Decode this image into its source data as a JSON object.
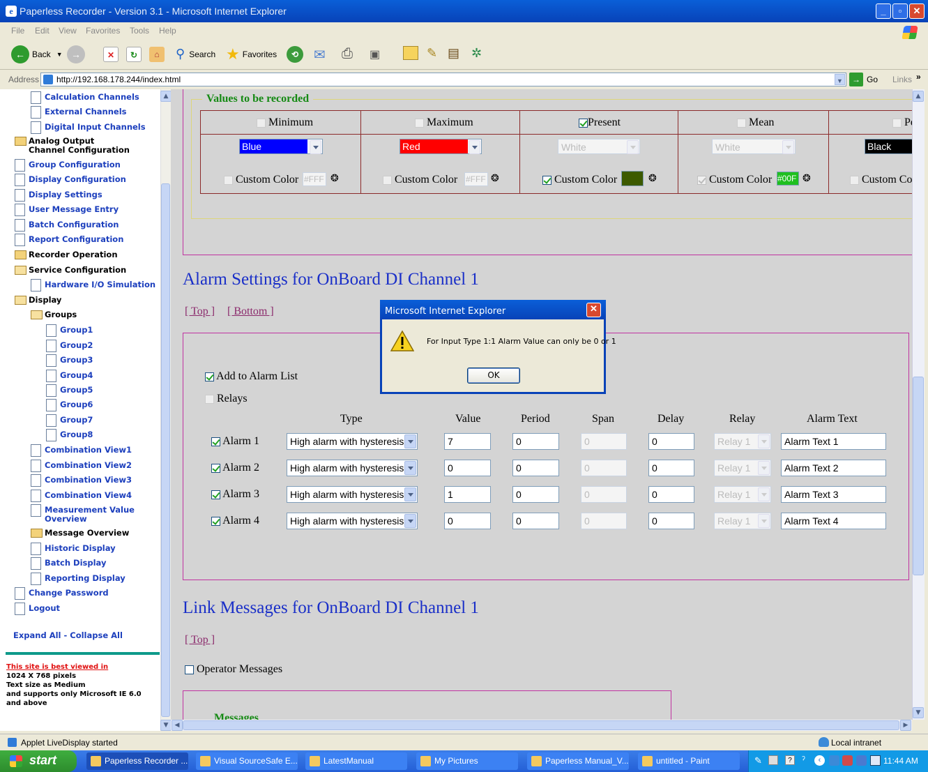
{
  "window": {
    "title": "Paperless Recorder - Version 3.1 - Microsoft Internet Explorer"
  },
  "menu": [
    "File",
    "Edit",
    "View",
    "Favorites",
    "Tools",
    "Help"
  ],
  "toolbar": {
    "back": "Back",
    "search": "Search",
    "favorites": "Favorites"
  },
  "address": {
    "label": "Address",
    "url": "http://192.168.178.244/index.html",
    "go": "Go",
    "links": "Links"
  },
  "sidebar": {
    "items": [
      {
        "label": "Calculation Channels"
      },
      {
        "label": "External Channels"
      },
      {
        "label": "Digital Input Channels"
      },
      {
        "label": "Analog Output Channel Configuration"
      },
      {
        "label": "Group Configuration"
      },
      {
        "label": "Display Configuration"
      },
      {
        "label": "Display Settings"
      },
      {
        "label": "User Message Entry"
      },
      {
        "label": "Batch Configuration"
      },
      {
        "label": "Report Configuration"
      },
      {
        "label": "Recorder Operation"
      },
      {
        "label": "Service Configuration"
      },
      {
        "label": "Hardware I/O Simulation"
      },
      {
        "label": "Display"
      },
      {
        "label": "Groups"
      },
      {
        "label": "Group1"
      },
      {
        "label": "Group2"
      },
      {
        "label": "Group3"
      },
      {
        "label": "Group4"
      },
      {
        "label": "Group5"
      },
      {
        "label": "Group6"
      },
      {
        "label": "Group7"
      },
      {
        "label": "Group8"
      },
      {
        "label": "Combination View1"
      },
      {
        "label": "Combination View2"
      },
      {
        "label": "Combination View3"
      },
      {
        "label": "Combination View4"
      },
      {
        "label": "Measurement Value Overview"
      },
      {
        "label": "Message Overview"
      },
      {
        "label": "Historic Display"
      },
      {
        "label": "Batch Display"
      },
      {
        "label": "Reporting Display"
      },
      {
        "label": "Change Password"
      },
      {
        "label": "Logout"
      }
    ],
    "expand_all": "Expand All",
    "separator": " - ",
    "collapse_all": "Collapse All",
    "notice_link": "This site is best viewed in",
    "notice_lines": [
      "1024 X 768 pixels",
      "Text size as Medium",
      "and supports only Microsoft IE 6.0",
      "and above"
    ]
  },
  "values_section": {
    "legend": "Values to be recorded",
    "columns": [
      {
        "label": "Minimum",
        "checked": false,
        "color": "Blue",
        "color_hex": "#0000ff",
        "custom_label": "Custom Color",
        "custom_checked": false,
        "custom_value": "#FFF",
        "custom_hex": "#ffffff"
      },
      {
        "label": "Maximum",
        "checked": false,
        "color": "Red",
        "color_hex": "#ff0000",
        "custom_label": "Custom Color",
        "custom_checked": false,
        "custom_value": "#FFF",
        "custom_hex": "#ffffff"
      },
      {
        "label": "Present",
        "checked": true,
        "color": "White",
        "color_hex": "#ffffff",
        "custom_label": "Custom Color",
        "custom_checked": true,
        "custom_value": "",
        "custom_hex": "#3c5a00"
      },
      {
        "label": "Mean",
        "checked": false,
        "color": "White",
        "color_hex": "#ffffff",
        "custom_label": "Custom Color",
        "custom_checked": true,
        "custom_value": "#00F",
        "custom_hex": "#1fbf1f"
      },
      {
        "label": "Pe",
        "checked": false,
        "color": "Black",
        "color_hex": "#000000",
        "custom_label": "Custom Co",
        "custom_checked": false,
        "custom_value": "",
        "custom_hex": "#ffffff"
      }
    ]
  },
  "alarm_section": {
    "title": "Alarm Settings for OnBoard DI Channel 1",
    "link_top": "[ Top ]",
    "link_bottom": "[ Bottom ]",
    "add_to_alarm_list": "Add to Alarm List",
    "relays": "Relays",
    "headers": {
      "type": "Type",
      "value": "Value",
      "period": "Period",
      "span": "Span",
      "delay": "Delay",
      "relay": "Relay",
      "text": "Alarm Text"
    },
    "rows": [
      {
        "label": "Alarm 1",
        "type": "High alarm with hysteresis",
        "value": "7",
        "period": "0",
        "span": "0",
        "delay": "0",
        "relay": "Relay 1",
        "text": "Alarm Text 1"
      },
      {
        "label": "Alarm 2",
        "type": "High alarm with hysteresis",
        "value": "0",
        "period": "0",
        "span": "0",
        "delay": "0",
        "relay": "Relay 1",
        "text": "Alarm Text 2"
      },
      {
        "label": "Alarm 3",
        "type": "High alarm with hysteresis",
        "value": "1",
        "period": "0",
        "span": "0",
        "delay": "0",
        "relay": "Relay 1",
        "text": "Alarm Text 3"
      },
      {
        "label": "Alarm 4",
        "type": "High alarm with hysteresis",
        "value": "0",
        "period": "0",
        "span": "0",
        "delay": "0",
        "relay": "Relay 1",
        "text": "Alarm Text 4"
      }
    ]
  },
  "link_section": {
    "title": "Link Messages for OnBoard DI Channel 1",
    "link_top": "[ Top ]",
    "operator_messages": "Operator Messages",
    "messages_legend": "Messages"
  },
  "dialog": {
    "title": "Microsoft Internet Explorer",
    "message": "For Input Type 1:1 Alarm Value can only be 0 or 1",
    "ok": "OK"
  },
  "status": {
    "text": "Applet LiveDisplay started",
    "zone": "Local intranet"
  },
  "taskbar": {
    "start": "start",
    "tasks": [
      "Paperless Recorder ...",
      "Visual SourceSafe E...",
      "LatestManual",
      "My Pictures",
      "Paperless Manual_V...",
      "untitled - Paint"
    ],
    "clock": "11:44 AM"
  },
  "colors": {
    "link_blue": "#1a2fc8",
    "frame_magenta": "#c032a0",
    "legend_green": "#158a14",
    "table_border": "#8b2a2a"
  }
}
